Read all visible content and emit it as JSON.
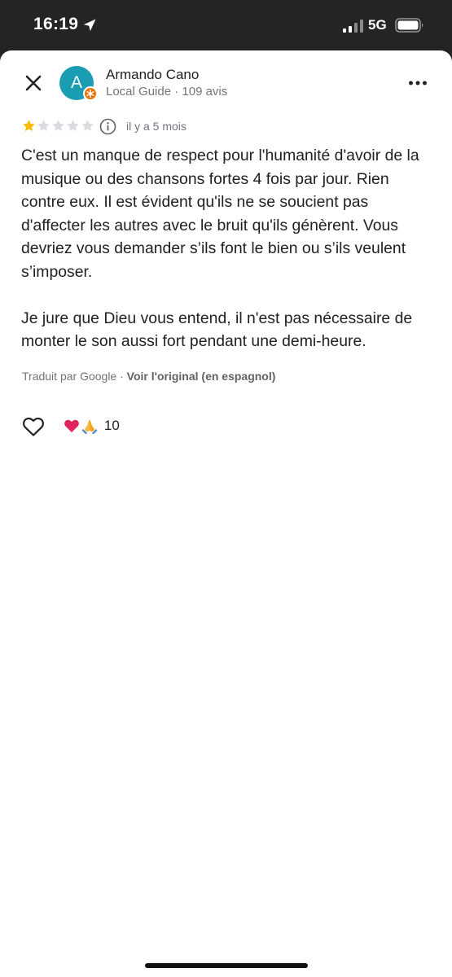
{
  "status_bar": {
    "time": "16:19",
    "network": "5G"
  },
  "review": {
    "author": {
      "initial": "A",
      "name": "Armando Cano",
      "meta": "Local Guide · 109 avis"
    },
    "rating": 1,
    "rating_max": 5,
    "date": "il y a 5 mois",
    "paragraphs": [
      "C'est un manque de respect pour l'humanité d'avoir de la musique ou des chansons fortes 4 fois par jour. Rien contre eux. Il est évident qu'ils ne se soucient pas d'affecter les autres avec le bruit qu'ils génèrent. Vous devriez vous demander s’ils font le bien ou s’ils veulent s’imposer.",
      "Je jure que Dieu vous entend, il n'est pas nécessaire de monter le son aussi fort pendant une demi-heure."
    ],
    "translation": {
      "prefix": "Traduit par Google · ",
      "link": "Voir l'original (en espagnol)"
    },
    "reactions": {
      "emojis": [
        "red-heart",
        "folded-hands"
      ],
      "count": "10"
    }
  },
  "colors": {
    "avatar": "#1a9db2",
    "guide_badge": "#e8710a",
    "star_filled": "#fbbc04",
    "star_empty": "#dadce0"
  }
}
